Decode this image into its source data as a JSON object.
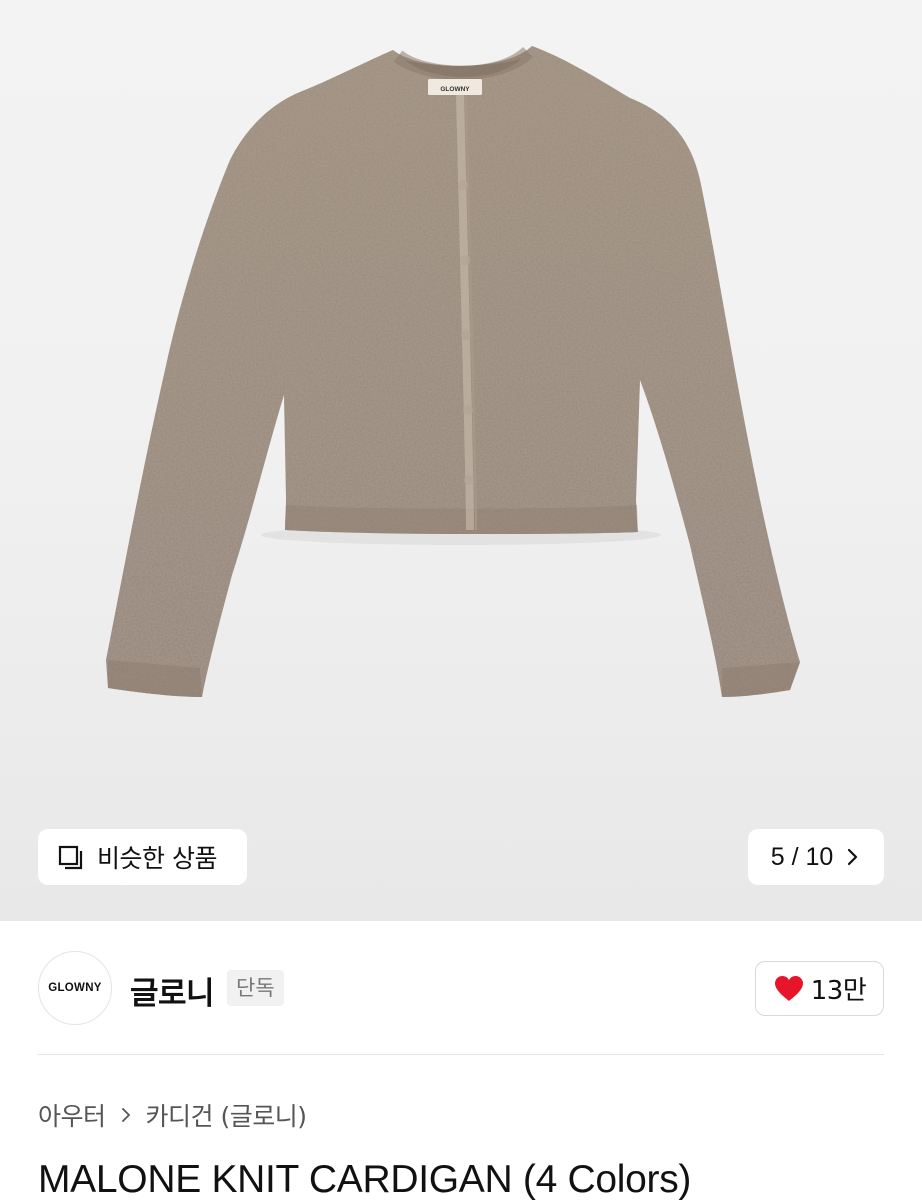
{
  "hero": {
    "image_icon": "cardigan-product-image",
    "label_tag": "GLOWNY",
    "similar_button": {
      "icon": "similar-items-icon",
      "label": "비슷한 상품"
    },
    "image_counter": {
      "text": "5 / 10",
      "icon": "chevron-right-icon"
    }
  },
  "brand": {
    "logo_text": "GLOWNY",
    "name": "글로니",
    "badge": "단독",
    "like": {
      "icon": "heart-icon",
      "count": "13만",
      "color": "#e8142b"
    }
  },
  "breadcrumb": {
    "items": [
      "아우터",
      "카디건 (글로니)"
    ],
    "separator_icon": "chevron-right-icon"
  },
  "product": {
    "title": "MALONE KNIT CARDIGAN (4 Colors)"
  },
  "colors": {
    "knit": "#9b8b7a",
    "knit_dark": "#7d6d5e",
    "background": "#f2f2f2"
  }
}
